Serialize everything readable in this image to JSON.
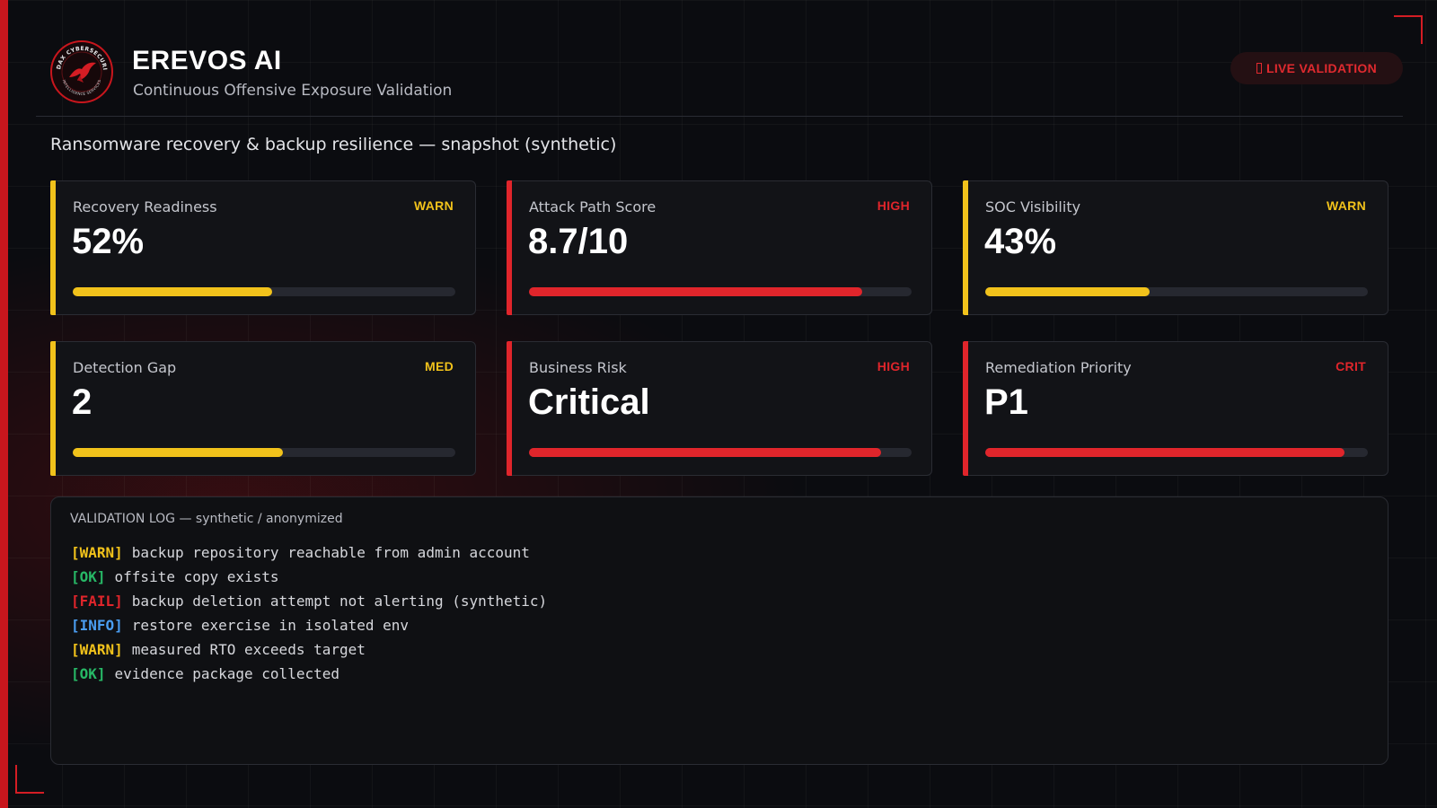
{
  "app": {
    "title": "EREVOS AI",
    "subtitle": "Continuous Offensive Exposure Validation",
    "logo_text_top": "AUDAX CYBERSECURITY",
    "logo_text_bottom": "INTELLIGENCE SERVICES",
    "live_badge": "LIVE VALIDATION"
  },
  "colors": {
    "brand_red": "#c8161d",
    "warn": "#f1c21b",
    "high": "#e0252b",
    "ok": "#27b866",
    "info": "#4a9df0"
  },
  "snapshot_title": "Ransomware recovery & backup resilience — snapshot (synthetic)",
  "cards": [
    {
      "label": "Recovery Readiness",
      "badge": "WARN",
      "value": "52%",
      "progress": 0.52,
      "color": "#f1c21b"
    },
    {
      "label": "Attack Path Score",
      "badge": "HIGH",
      "value": "8.7/10",
      "progress": 0.87,
      "color": "#e0252b"
    },
    {
      "label": "SOC Visibility",
      "badge": "WARN",
      "value": "43%",
      "progress": 0.43,
      "color": "#f1c21b"
    },
    {
      "label": "Detection Gap",
      "badge": "MED",
      "value": "2",
      "progress": 0.55,
      "color": "#f1c21b"
    },
    {
      "label": "Business Risk",
      "badge": "HIGH",
      "value": "Critical",
      "progress": 0.92,
      "color": "#e0252b"
    },
    {
      "label": "Remediation Priority",
      "badge": "CRIT",
      "value": "P1",
      "progress": 0.94,
      "color": "#e0252b"
    }
  ],
  "log": {
    "title": "VALIDATION LOG — synthetic / anonymized",
    "lines": [
      {
        "tag": "[WARN]",
        "level": "warn",
        "text": "backup repository reachable from admin account"
      },
      {
        "tag": "[OK]",
        "level": "ok",
        "text": "offsite copy exists"
      },
      {
        "tag": "[FAIL]",
        "level": "fail",
        "text": "backup deletion attempt not alerting (synthetic)"
      },
      {
        "tag": "[INFO]",
        "level": "info",
        "text": "restore exercise in isolated env"
      },
      {
        "tag": "[WARN]",
        "level": "warn",
        "text": "measured RTO exceeds target"
      },
      {
        "tag": "[OK]",
        "level": "ok",
        "text": "evidence package collected"
      }
    ]
  }
}
